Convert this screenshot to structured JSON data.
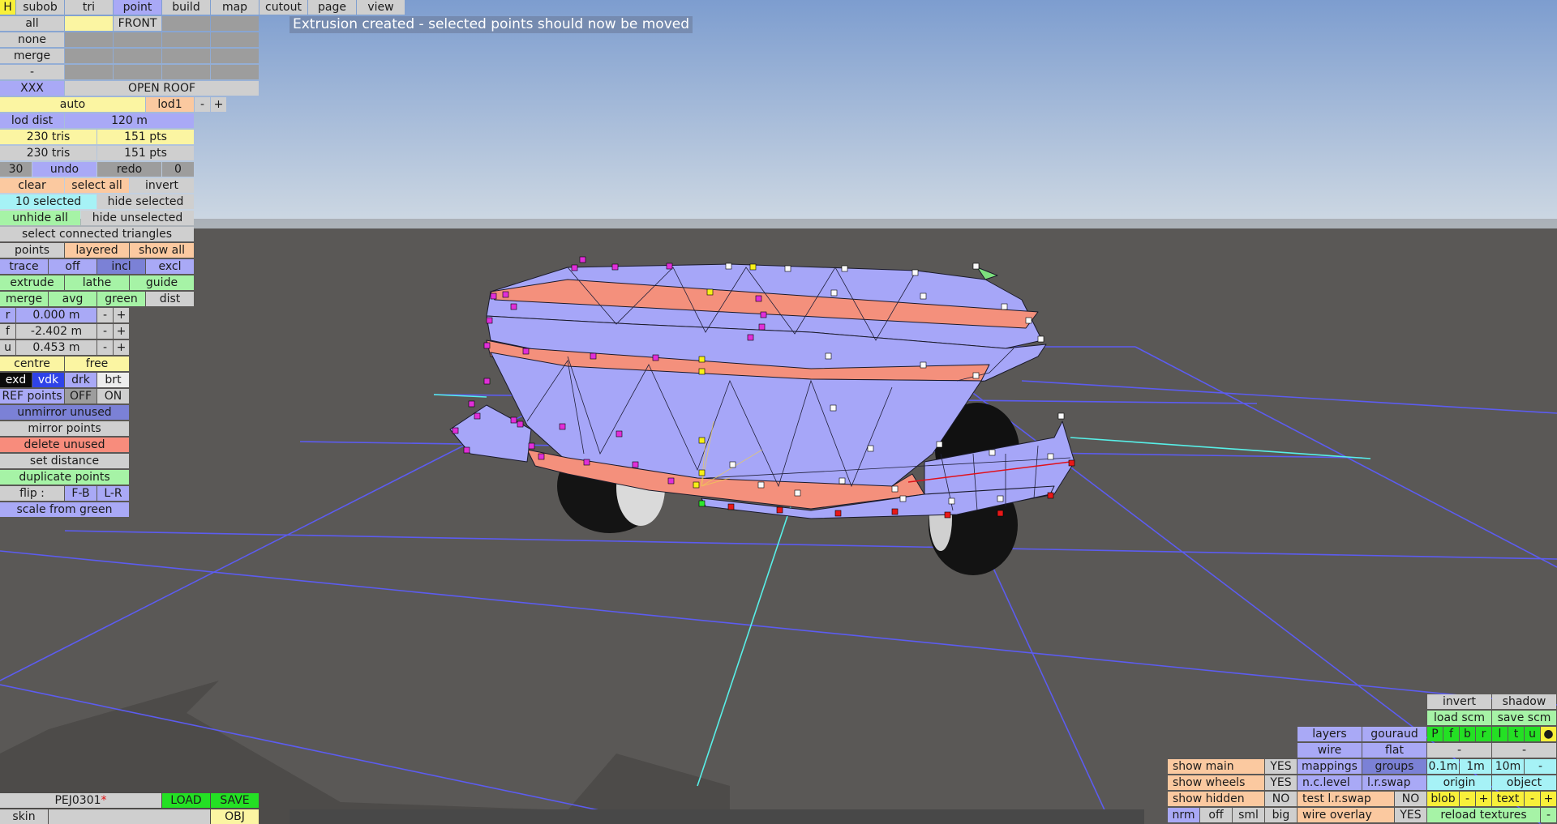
{
  "status_message": "Extrusion created - selected points should now be moved",
  "top_tabs": [
    "H",
    "subob",
    "tri",
    "point",
    "build",
    "map",
    "cutout",
    "page",
    "view"
  ],
  "active_tab": "point",
  "left_panel": {
    "all": "all",
    "front": "FRONT",
    "none": "none",
    "merge_top": "merge",
    "dash": "-",
    "xxx": "XXX",
    "open_roof": "OPEN ROOF",
    "auto": "auto",
    "lod1": "lod1",
    "minus": "-",
    "plus": "+",
    "lod_dist_label": "lod dist",
    "lod_dist_value": "120 m",
    "tris_a": "230 tris",
    "pts_a": "151 pts",
    "tris_b": "230 tris",
    "pts_b": "151 pts",
    "undo_count": "30",
    "undo": "undo",
    "redo": "redo",
    "redo_count": "0",
    "clear": "clear",
    "select_all": "select all",
    "invert": "invert",
    "selected_count": "10 selected",
    "hide_selected": "hide selected",
    "unhide_all": "unhide all",
    "hide_unselected": "hide unselected",
    "select_connected": "select connected triangles",
    "points": "points",
    "layered": "layered",
    "show_all": "show all",
    "trace": "trace",
    "off": "off",
    "incl": "incl",
    "excl": "excl",
    "extrude": "extrude",
    "lathe": "lathe",
    "guide": "guide",
    "merge": "merge",
    "avg": "avg",
    "green": "green",
    "dist": "dist",
    "r_label": "r",
    "r_value": "0.000 m",
    "f_label": "f",
    "f_value": "-2.402 m",
    "u_label": "u",
    "u_value": "0.453 m",
    "centre": "centre",
    "free": "free",
    "exd": "exd",
    "vdk": "vdk",
    "drk": "drk",
    "brt": "brt",
    "ref_points": "REF points",
    "ref_off": "OFF",
    "ref_on": "ON",
    "unmirror_unused": "unmirror unused",
    "mirror_points": "mirror points",
    "delete_unused": "delete unused",
    "set_distance": "set distance",
    "duplicate_points": "duplicate points",
    "flip": "flip :",
    "flip_fb": "F-B",
    "flip_lr": "L-R",
    "scale_from_green": "scale from green"
  },
  "bottom_left": {
    "filename": "PEJ0301",
    "modified_mark": "*",
    "load": "LOAD",
    "save": "SAVE",
    "skin": "skin",
    "obj": "OBJ"
  },
  "bottom_right": {
    "invert": "invert",
    "shadow": "shadow",
    "load_scm": "load scm",
    "save_scm": "save scm",
    "views": [
      "P",
      "f",
      "b",
      "r",
      "l",
      "t",
      "u"
    ],
    "dot": "●",
    "dash1": "-",
    "dash2": "-",
    "layers": "layers",
    "gouraud": "gouraud",
    "wire": "wire",
    "flat": "flat",
    "mappings": "mappings",
    "groups": "groups",
    "nc_level": "n.c.level",
    "lr_swap": "l.r.swap",
    "test_lr_swap": "test l.r.swap",
    "test_lr_swap_val": "NO",
    "wire_overlay": "wire overlay",
    "wire_overlay_val": "YES",
    "show_main": "show main",
    "show_main_val": "YES",
    "show_wheels": "show wheels",
    "show_wheels_val": "YES",
    "show_hidden": "show hidden",
    "show_hidden_val": "NO",
    "nrm": "nrm",
    "off": "off",
    "sml": "sml",
    "big": "big",
    "step_01": "0.1m",
    "step_1": "1m",
    "step_10": "10m",
    "step_minus": "-",
    "origin": "origin",
    "object": "object",
    "blob": "blob",
    "blob_minus": "-",
    "blob_plus": "+",
    "text": "text",
    "text_minus": "-",
    "text_plus": "+",
    "reload_textures": "reload textures",
    "reload_minus": "-"
  },
  "colors": {
    "mesh_blue": "#a6a6f8",
    "mesh_band": "#f4907c",
    "sky_top": "#7f9fd0",
    "ground": "#5a5856",
    "grid": "#5c5cf0"
  }
}
